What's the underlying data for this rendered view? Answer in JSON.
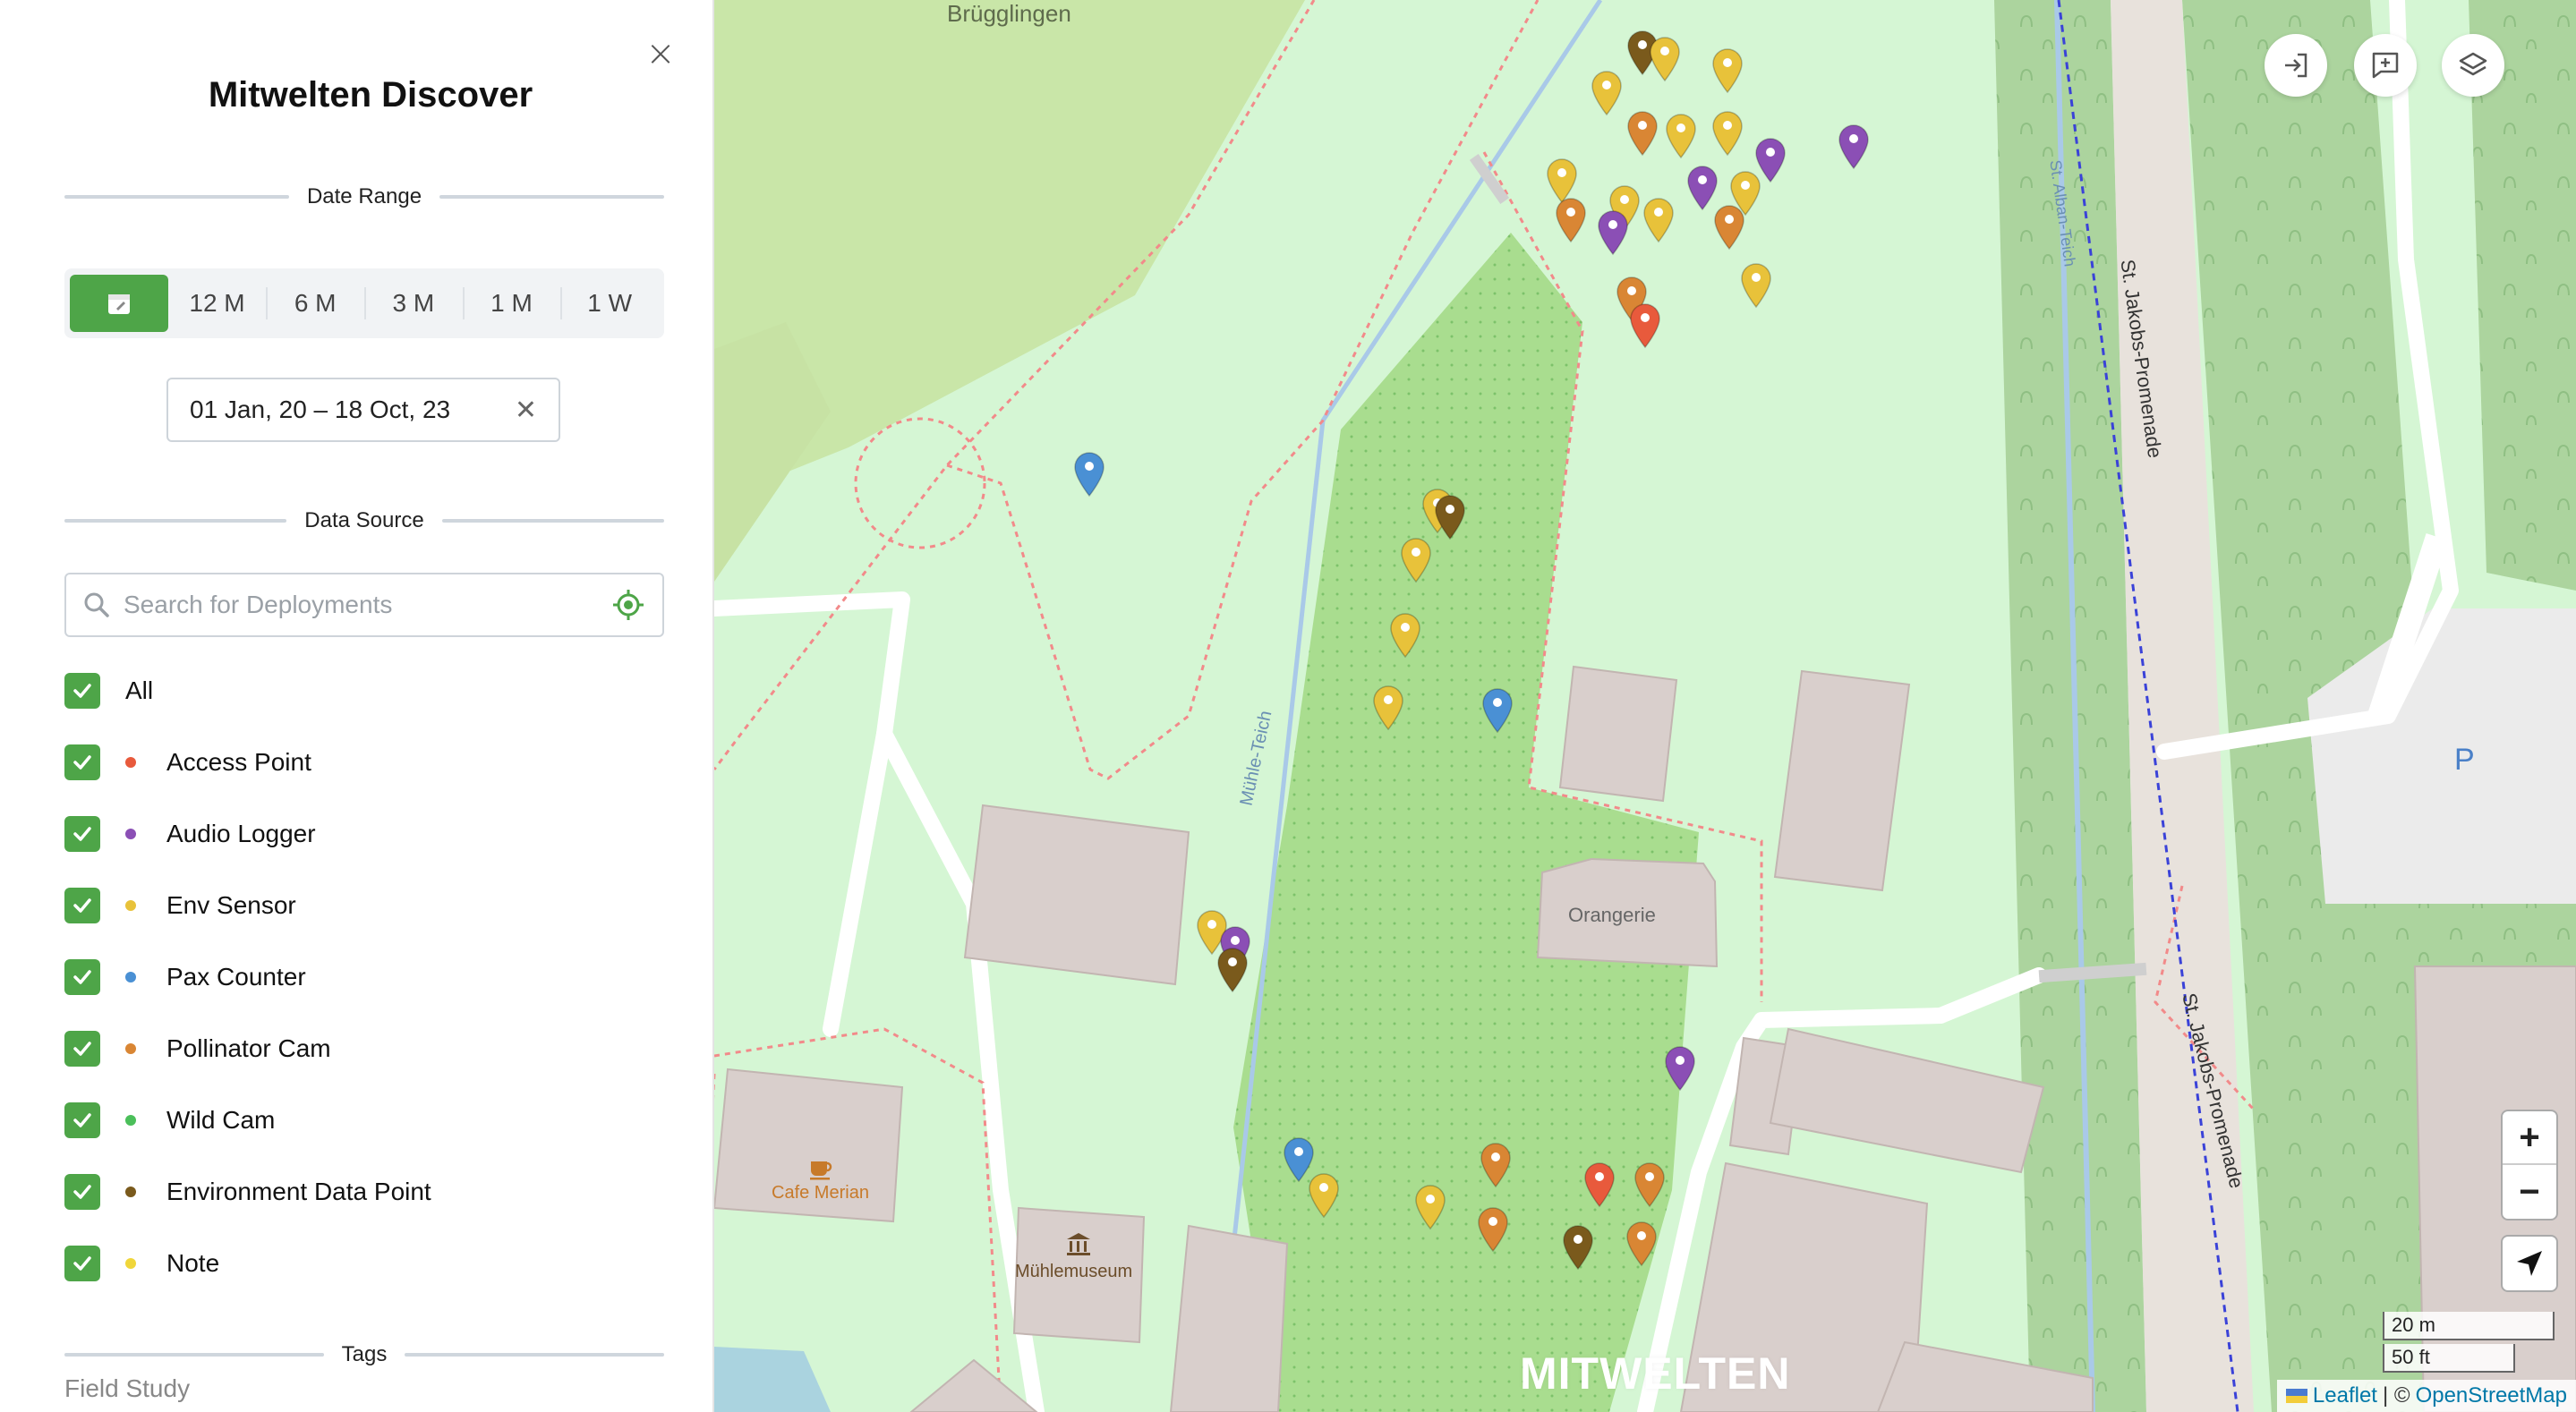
{
  "app": {
    "title": "Mitwelten Discover"
  },
  "filters": {
    "date_range_label": "Date Range",
    "range_buttons": [
      {
        "label": "",
        "icon": "calendar-icon",
        "active": true
      },
      {
        "label": "12 M",
        "active": false
      },
      {
        "label": "6 M",
        "active": false
      },
      {
        "label": "3 M",
        "active": false
      },
      {
        "label": "1 M",
        "active": false
      },
      {
        "label": "1 W",
        "active": false
      }
    ],
    "date_value": "01 Jan, 20 – 18 Oct, 23",
    "data_source_label": "Data Source",
    "search_placeholder": "Search for Deployments",
    "sources": [
      {
        "label": "All",
        "checked": true,
        "color": ""
      },
      {
        "label": "Access Point",
        "checked": true,
        "color": "#e85a3c"
      },
      {
        "label": "Audio Logger",
        "checked": true,
        "color": "#8b4fb5"
      },
      {
        "label": "Env Sensor",
        "checked": true,
        "color": "#e8c23a"
      },
      {
        "label": "Pax Counter",
        "checked": true,
        "color": "#4a90d4"
      },
      {
        "label": "Pollinator Cam",
        "checked": true,
        "color": "#d98634"
      },
      {
        "label": "Wild Cam",
        "checked": true,
        "color": "#4bbf5a"
      },
      {
        "label": "Environment Data Point",
        "checked": true,
        "color": "#7a5a1c"
      },
      {
        "label": "Note",
        "checked": true,
        "color": "#f0d63a"
      }
    ],
    "tags_label": "Tags",
    "tags_field": "Field Study"
  },
  "map": {
    "labels": {
      "area": "Brügglingen",
      "stream": "Mühle-Teich",
      "canal": "St. Alban-Teich",
      "street1": "St. Jakobs-Promenade",
      "street2": "St. Jakobs-Promenade",
      "building": "Orangerie",
      "cafe": "Cafe Merian",
      "museum": "Mühlemuseum",
      "parking": "P"
    },
    "scale": {
      "metric": "20 m",
      "imperial": "50 ft"
    },
    "attribution": {
      "leaflet": "Leaflet",
      "sep": "| ©",
      "osm": "OpenStreetMap"
    },
    "watermark": "MITWELTEN",
    "zoom_in": "+",
    "zoom_out": "−",
    "controls": [
      "login-icon",
      "add-note-icon",
      "layers-icon"
    ]
  },
  "colors": {
    "accent": "#4ea548",
    "access_point": "#e85a3c",
    "audio_logger": "#8b4fb5",
    "env_sensor": "#e8c23a",
    "pax_counter": "#4a90d4",
    "pollinator_cam": "#d98634",
    "env_data_point": "#7a5a1c"
  }
}
